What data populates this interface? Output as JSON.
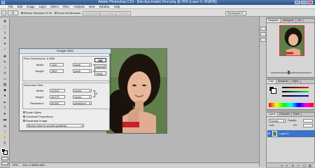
{
  "app": {
    "icon_label": "Ps",
    "window_title": "Adobe Photoshop CS3 - [Isla Ayu Kadek Devi.png @ 25% (Layer 0, RGB/8)]"
  },
  "menu": [
    "File",
    "Edit",
    "Image",
    "Layer",
    "Select",
    "Filter",
    "Analysis",
    "View",
    "Window",
    "Help"
  ],
  "options_bar": {
    "resize_windows": "Resize Windows To Fit",
    "zoom_all": "Zoom All Windows",
    "actual_pixels": "Actual Pixels",
    "fit_screen": "Fit Screen",
    "print_size": "Print Size",
    "workspace": "Workspace ▾"
  },
  "dialog": {
    "title": "Image Size",
    "pixel_dimensions": "Pixel Dimensions:",
    "pixel_size": "5.36M",
    "width_label": "Width:",
    "width_value": "1200",
    "width_unit": "pixels",
    "height_label": "Height:",
    "height_value": "1563",
    "height_unit": "pixels",
    "document_size": "Document Size:",
    "doc_width_value": "12.502",
    "doc_width_unit": "inches",
    "doc_height_value": "16.075",
    "doc_height_unit": "inches",
    "resolution_label": "Resolution:",
    "resolution_value": "95.987",
    "resolution_unit": "pixels/inch",
    "scale_styles": "Scale Styles",
    "constrain": "Constrain Proportions",
    "resample": "Resample Image:",
    "resample_method": "Bicubic (best for smooth gradients)",
    "ok": "OK",
    "cancel": "Cancel",
    "auto": "Auto..."
  },
  "panels": {
    "navigator_tabs": [
      "Navigator",
      "Histogram",
      "Info"
    ],
    "color_tabs": [
      "Color",
      "Swatches",
      "Styles"
    ],
    "layers_tabs": [
      "Layers",
      "Channels",
      "Paths"
    ],
    "blend_mode": "Normal",
    "opacity_label": "Opacity:",
    "fill_label": "Fill:",
    "lock_label": "Lock:",
    "layer_name": "Layer 0"
  },
  "status": {
    "zoom": "25%",
    "doc": "Doc: 5.36M/5.36M"
  }
}
